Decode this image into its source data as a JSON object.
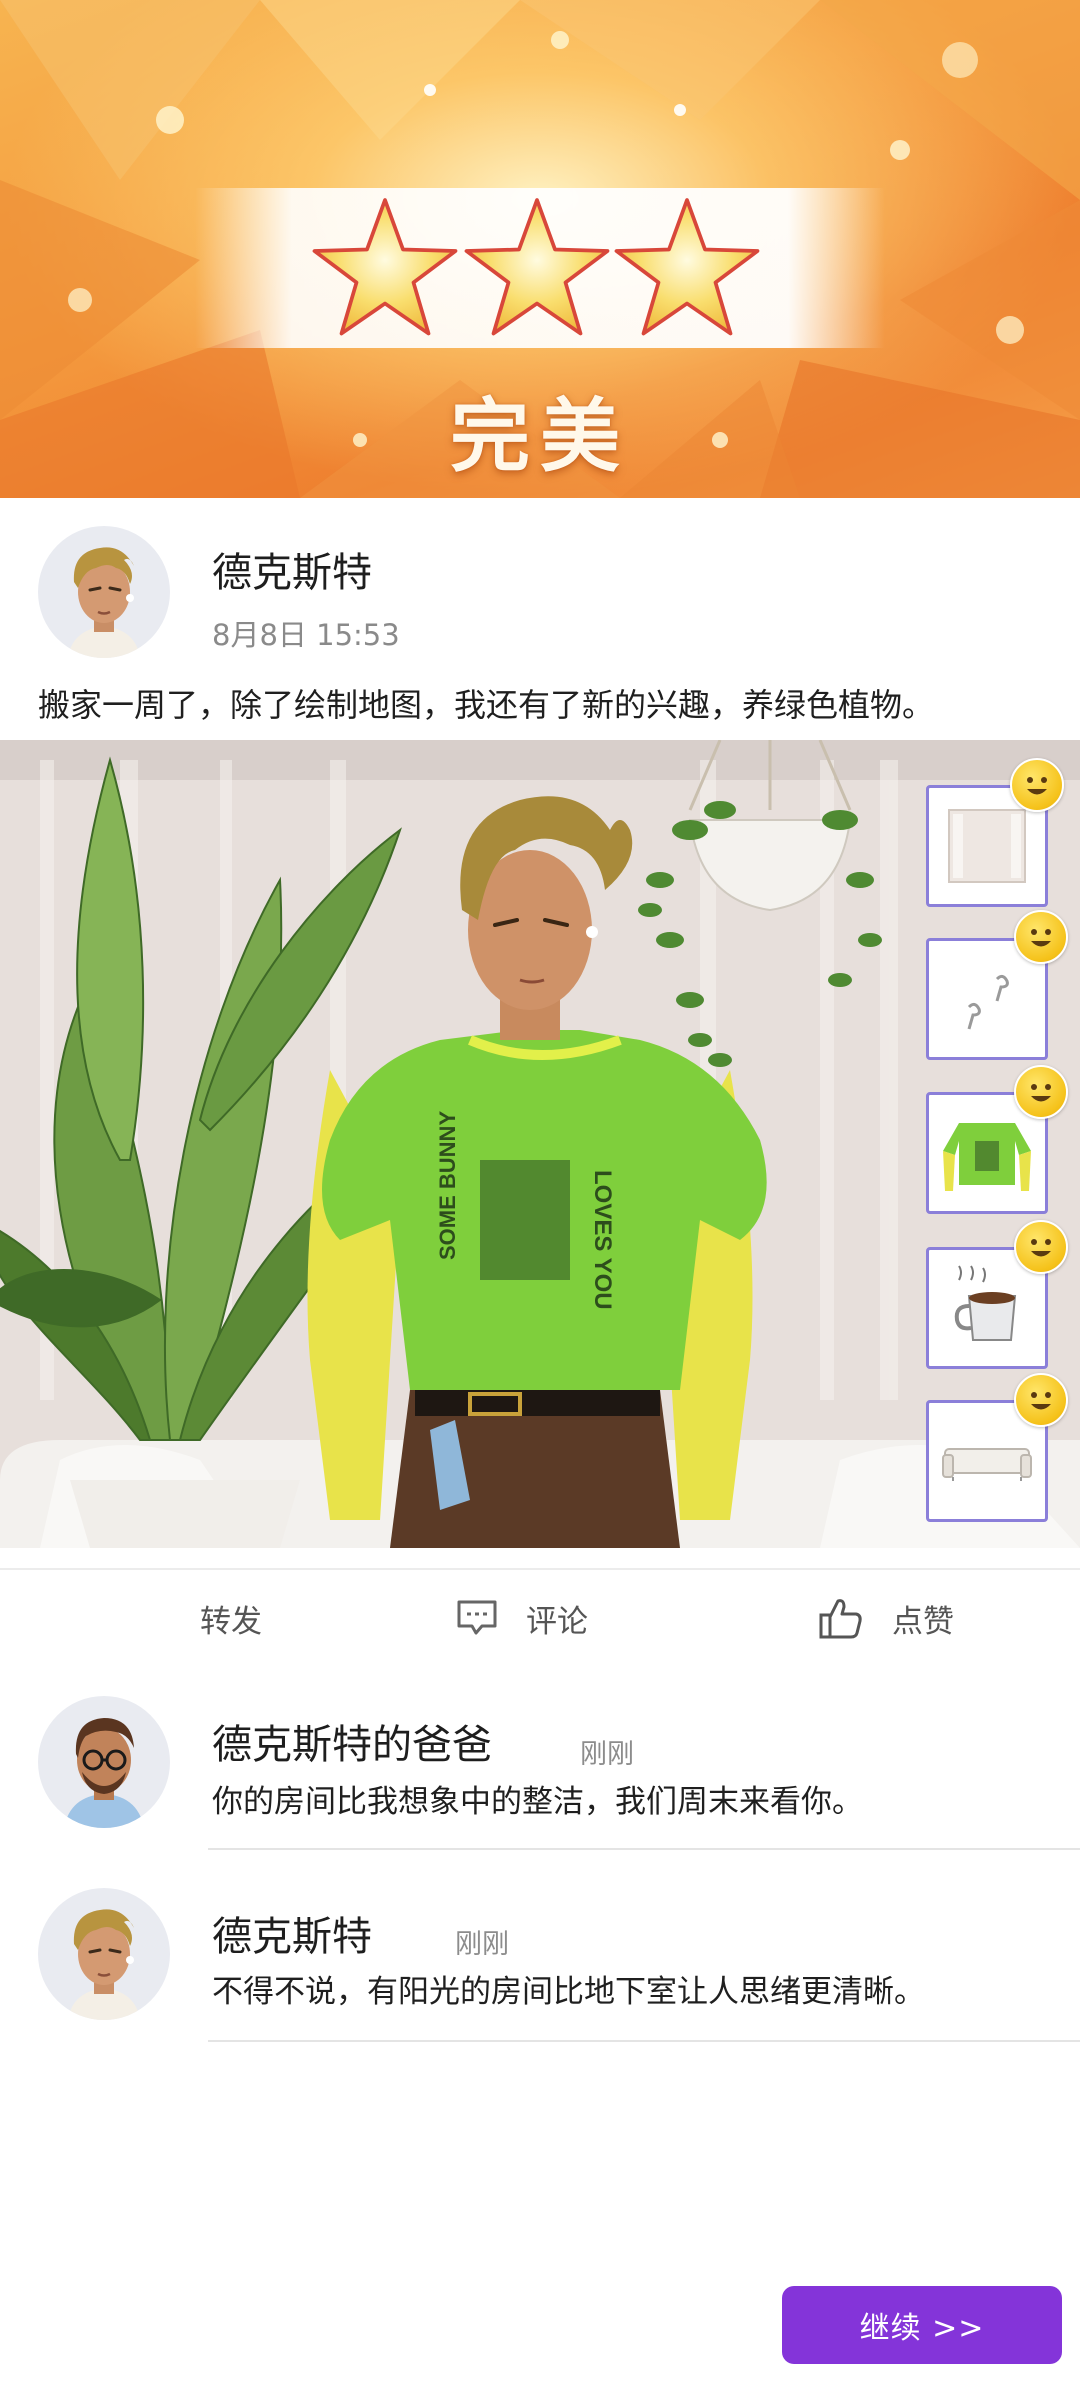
{
  "result": {
    "stars_earned": 3,
    "stars_total": 3,
    "rating_label": "完美"
  },
  "post": {
    "author": "德克斯特",
    "time": "8月8日 15:53",
    "text": "搬家一周了，除了绘制地图，我还有了新的兴趣，养绿色植物。",
    "shirt_text": "SOME BUNNY LOVES YOU"
  },
  "items": [
    {
      "name": "window-curtain",
      "rating": "smile"
    },
    {
      "name": "earbuds",
      "rating": "smile"
    },
    {
      "name": "green-layered-shirt",
      "rating": "smile"
    },
    {
      "name": "coffee-mug",
      "rating": "smile"
    },
    {
      "name": "white-sofa",
      "rating": "smile"
    }
  ],
  "actions": {
    "share": "转发",
    "comment": "评论",
    "like": "点赞"
  },
  "comments": [
    {
      "author": "德克斯特的爸爸",
      "time": "刚刚",
      "text": "你的房间比我想象中的整洁，我们周末来看你。"
    },
    {
      "author": "德克斯特",
      "time": "刚刚",
      "text": "不得不说，有阳光的房间比地下室让人思绪更清晰。"
    }
  ],
  "continue_label": "继续 >>",
  "colors": {
    "accent": "#8434d9",
    "item_border": "#8b7fd9",
    "star": "#f7d35a",
    "banner": "#f49a3e"
  }
}
